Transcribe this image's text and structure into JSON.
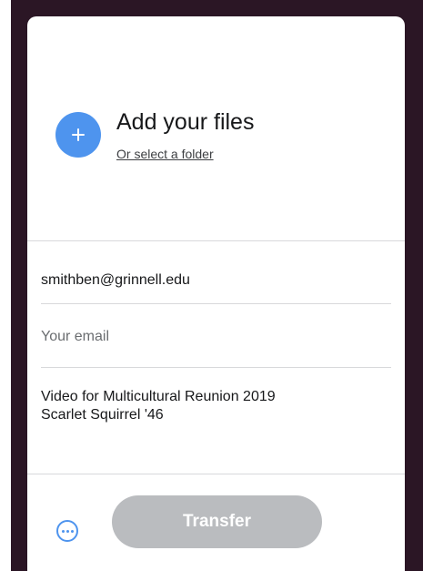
{
  "upload": {
    "title": "Add your files",
    "folder_link": "Or select a folder",
    "add_icon": "plus-icon"
  },
  "form": {
    "email_to_value": "smithben@grinnell.edu",
    "email_from_placeholder": "Your email",
    "message_value": "Video for Multicultural Reunion 2019\nScarlet Squirrel '46"
  },
  "footer": {
    "more_icon": "more-options-icon",
    "transfer_label": "Transfer"
  },
  "colors": {
    "accent": "#4e94ee",
    "button_disabled": "#babcbf",
    "backdrop": "#2b1625"
  }
}
